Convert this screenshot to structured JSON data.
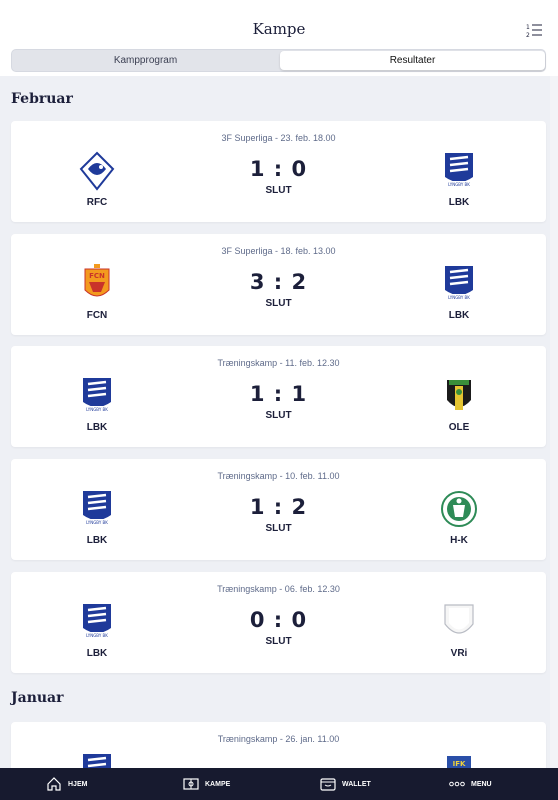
{
  "header": {
    "title": "Kampe"
  },
  "tabs": {
    "program": "Kampprogram",
    "results": "Resultater"
  },
  "months": {
    "feb": "Februar",
    "jan": "Januar"
  },
  "matches": [
    {
      "meta": "3F Superliga - 23. feb. 18.00",
      "home": "RFC",
      "away": "LBK",
      "score": "1 : 0",
      "status": "SLUT"
    },
    {
      "meta": "3F Superliga - 18. feb. 13.00",
      "home": "FCN",
      "away": "LBK",
      "score": "3 : 2",
      "status": "SLUT"
    },
    {
      "meta": "Træningskamp - 11. feb. 12.30",
      "home": "LBK",
      "away": "OLE",
      "score": "1 : 1",
      "status": "SLUT"
    },
    {
      "meta": "Træningskamp - 10. feb. 11.00",
      "home": "LBK",
      "away": "H-K",
      "score": "1 : 2",
      "status": "SLUT"
    },
    {
      "meta": "Træningskamp - 06. feb. 12.30",
      "home": "LBK",
      "away": "VRi",
      "score": "0 : 0",
      "status": "SLUT"
    },
    {
      "meta": "Træningskamp - 26. jan. 11.00"
    }
  ],
  "tabbar": {
    "home": "HJEM",
    "matches": "KAMPE",
    "wallet": "WALLET",
    "menu": "MENU"
  },
  "colors": {
    "navy": "#1c1f3a",
    "lyngby_blue": "#1f3a9a",
    "fcn_orange": "#f39a1e"
  }
}
